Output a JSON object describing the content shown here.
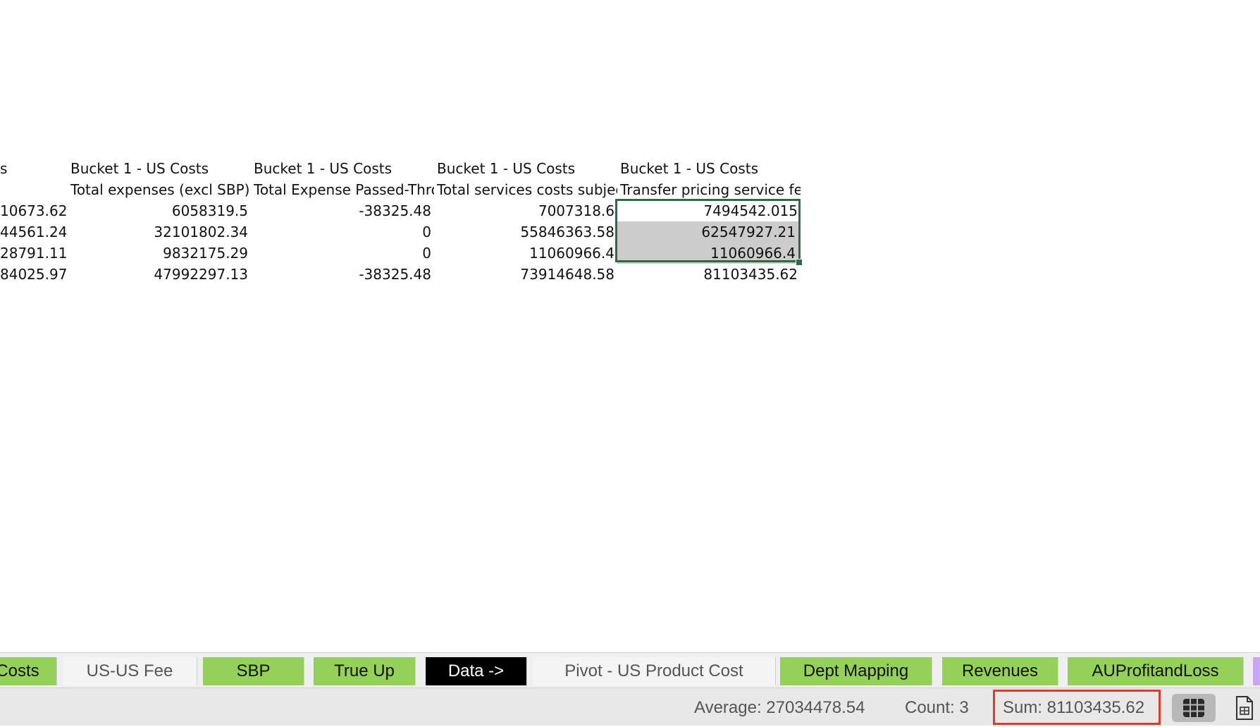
{
  "sheet": {
    "header_row_1": [
      "s",
      "Bucket 1 - US Costs",
      "Bucket 1 - US Costs",
      "Bucket 1 - US Costs",
      "Bucket 1 - US Costs"
    ],
    "header_row_2": [
      "",
      "Total expenses (excl SBP)",
      "Total Expense Passed-Through",
      "Total services costs subject to",
      "Transfer pricing service fee"
    ],
    "rows": [
      [
        "10673.62",
        "6058319.5",
        "-38325.48",
        "7007318.6",
        "7494542.015"
      ],
      [
        "44561.24",
        "32101802.34",
        "0",
        "55846363.58",
        "62547927.21"
      ],
      [
        "28791.11",
        "9832175.29",
        "0",
        "11060966.4",
        "11060966.4"
      ],
      [
        "84025.97",
        "47992297.13",
        "-38325.48",
        "73914648.58",
        "81103435.62"
      ]
    ],
    "selection_color": "#2e6b42"
  },
  "tabs": [
    {
      "label": "Costs",
      "style": "green"
    },
    {
      "label": "US-US Fee",
      "style": "plain"
    },
    {
      "label": "SBP",
      "style": "green"
    },
    {
      "label": "True Up",
      "style": "green"
    },
    {
      "label": "Data ->",
      "style": "dark"
    },
    {
      "label": "Pivot - US Product Cost",
      "style": "plain"
    },
    {
      "label": "Dept Mapping",
      "style": "green"
    },
    {
      "label": "Revenues",
      "style": "green"
    },
    {
      "label": "AUProfitandLoss",
      "style": "green"
    },
    {
      "label": "",
      "style": "purple"
    }
  ],
  "status": {
    "average": "Average: 27034478.54",
    "count": "Count: 3",
    "sum": "Sum: 81103435.62",
    "sum_highlight_color": "#e03a2a",
    "view_buttons": [
      "grid-icon",
      "page-layout-icon"
    ]
  }
}
